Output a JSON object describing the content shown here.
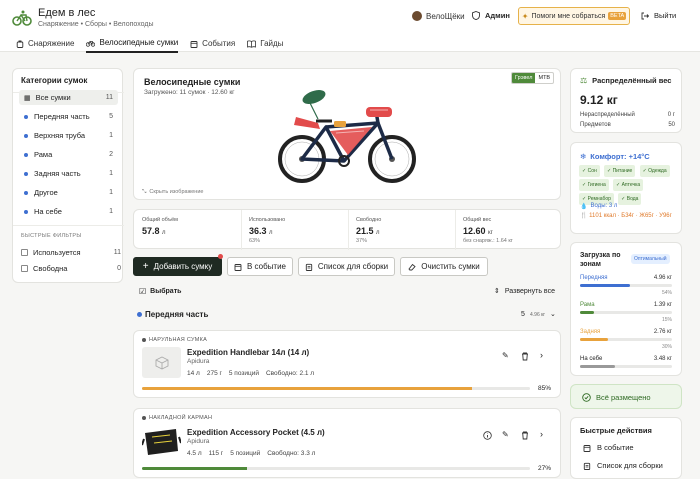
{
  "header": {
    "app_title": "Едем в лес",
    "breadcrumb": "Снаряжение • Сборы • Велопоходы",
    "user_name": "ВелоЩёки",
    "admin_label": "Админ",
    "help_label": "Помоги мне собраться",
    "beta_label": "BETA",
    "exit_label": "Выйти"
  },
  "tabs": [
    {
      "label": "Снаряжение",
      "icon": "backpack-icon",
      "active": false
    },
    {
      "label": "Велосипедные сумки",
      "icon": "bike-icon",
      "active": true
    },
    {
      "label": "События",
      "icon": "calendar-icon",
      "active": false
    },
    {
      "label": "Гайды",
      "icon": "book-icon",
      "active": false
    }
  ],
  "sidebar": {
    "title": "Категории сумок",
    "categories": [
      {
        "label": "Все сумки",
        "count": "11",
        "active": true
      },
      {
        "label": "Передняя часть",
        "count": "5"
      },
      {
        "label": "Верхняя труба",
        "count": "1"
      },
      {
        "label": "Рама",
        "count": "2"
      },
      {
        "label": "Задняя часть",
        "count": "1"
      },
      {
        "label": "Другое",
        "count": "1"
      },
      {
        "label": "На себе",
        "count": "1"
      }
    ],
    "quick_filters_title": "БЫСТРЫЕ ФИЛЬТРЫ",
    "filters": [
      {
        "label": "Используется",
        "count": "11"
      },
      {
        "label": "Свободна",
        "count": "0"
      }
    ]
  },
  "bike": {
    "title": "Велосипедные сумки",
    "subtitle": "Загружено: 11 сумок · 12.60 кг",
    "seg_options": [
      "Грэвел",
      "MTB"
    ],
    "hide_image": "Скрыть изображение",
    "colors": {
      "frame": "#1d2b47",
      "bag": "#e24b4b",
      "bag_top": "#2f6b4a",
      "bag_accent": "#e8a23c"
    }
  },
  "stats": [
    {
      "label": "Общий объём",
      "value": "57.8",
      "unit": "л",
      "sub": ""
    },
    {
      "label": "Использовано",
      "value": "36.3",
      "unit": "л",
      "sub": "63%"
    },
    {
      "label": "Свободно",
      "value": "21.5",
      "unit": "л",
      "sub": "37%"
    },
    {
      "label": "Общий вес",
      "value": "12.60",
      "unit": "кг",
      "sub": "без снаряж.: 1.64 кг"
    }
  ],
  "actions": {
    "add_bag": "Добавить сумку",
    "to_event": "В событие",
    "pack_list": "Список для сборки",
    "clear_bags": "Очистить сумки"
  },
  "list": {
    "select_label": "Выбрать",
    "expand_label": "Развернуть все",
    "group_title": "Передняя часть",
    "group_count": "5",
    "group_weight": "4.96 кг",
    "items": [
      {
        "type_label": "НАРУЛЬНАЯ СУМКА",
        "name": "Expedition Handlebar 14л (14 л)",
        "brand": "Apidura",
        "meta1": "14 л",
        "meta2": "275 г",
        "meta3": "5 позиций",
        "meta4": "Свободно: 2.1 л",
        "pct_label": "85%",
        "fill": 0.85,
        "bar_color": "#e8a23c"
      },
      {
        "type_label": "НАКЛАДНОЙ КАРМАН",
        "name": "Expedition Accessory Pocket (4.5 л)",
        "brand": "Apidura",
        "meta1": "4.5 л",
        "meta2": "115 г",
        "meta3": "5 позиций",
        "meta4": "Свободно: 3.3 л",
        "pct_label": "27%",
        "fill": 0.27,
        "bar_color": "#4f8a3a"
      }
    ]
  },
  "right": {
    "weight_title": "Распределённый вес",
    "weight_value": "9.12 кг",
    "unassigned_label": "Нераспределённый",
    "unassigned_value": "0 г",
    "items_label": "Предметов",
    "items_value": "50",
    "comfort_title": "Комфорт: +14°C",
    "chips": [
      "Сон",
      "Питание",
      "Одежда",
      "Гигиена",
      "Аптечка",
      "Ремнабор",
      "Вода"
    ],
    "water": "Воды: 3 л",
    "nutrition": "1101 ккал · Б34г · Ж65г · У96г",
    "zones_title": "Загрузка по зонам",
    "zones_badge": "Оптимальный",
    "zones": [
      {
        "name": "Передняя",
        "value": "4.96 кг",
        "pct": "54%",
        "fill": 0.54,
        "color": "#3e6fd1"
      },
      {
        "name": "Рама",
        "value": "1.39 кг",
        "pct": "15%",
        "fill": 0.15,
        "color": "#4f8a3a"
      },
      {
        "name": "Задняя",
        "value": "2.76 кг",
        "pct": "30%",
        "fill": 0.3,
        "color": "#e8a23c"
      },
      {
        "name": "На себе",
        "value": "3.48 кг",
        "pct": "",
        "fill": 0.38,
        "color": "#999999"
      }
    ],
    "all_placed": "Всё размещено",
    "quick_title": "Быстрые действия",
    "quick_to_event": "В событие",
    "quick_pack_list": "Список для сборки"
  }
}
